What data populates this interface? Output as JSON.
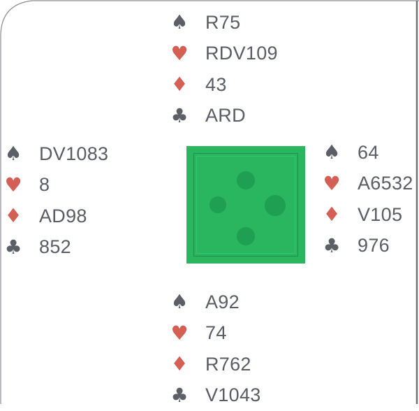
{
  "deal": {
    "north": {
      "spades": "R75",
      "hearts": "RDV109",
      "diamonds": "43",
      "clubs": "ARD"
    },
    "west": {
      "spades": "DV1083",
      "hearts": "8",
      "diamonds": "AD98",
      "clubs": "852"
    },
    "east": {
      "spades": "64",
      "hearts": "A6532",
      "diamonds": "V105",
      "clubs": "976"
    },
    "south": {
      "spades": "A92",
      "hearts": "74",
      "diamonds": "R762",
      "clubs": "V1043"
    }
  },
  "suits": {
    "spades": "♠",
    "hearts": "♥",
    "diamonds": "♦",
    "clubs": "♣"
  },
  "colors": {
    "table_green": "#29b65f",
    "red_suit": "#d35f55",
    "black_suit": "#5c5f66",
    "text": "#5a5d66"
  },
  "table_icon": "bridge-table-compass-icon"
}
